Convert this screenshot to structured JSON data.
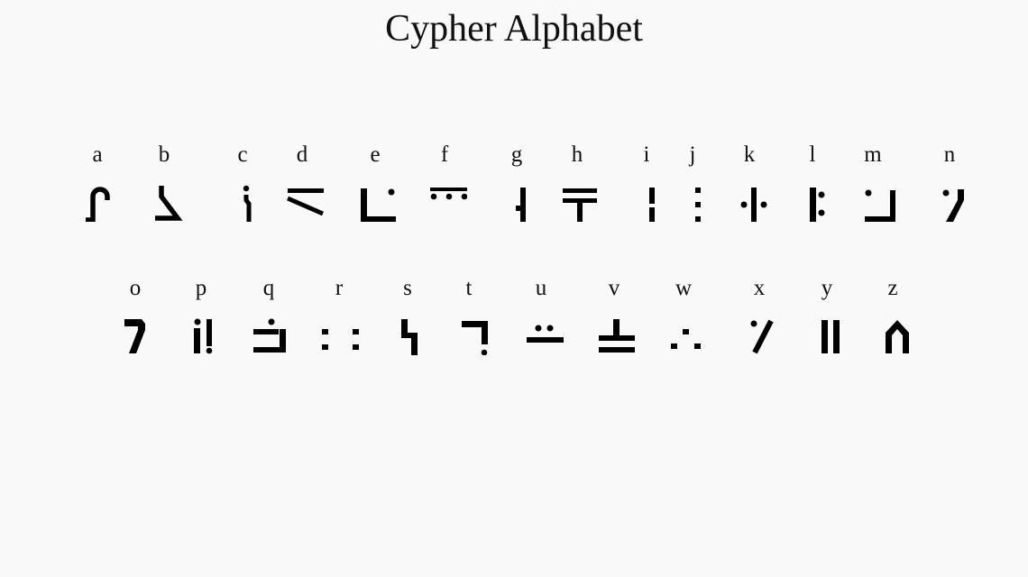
{
  "title": "Cypher Alphabet",
  "background_color": "#f9f9f9",
  "glyph_color": "#000000",
  "rows": [
    {
      "glyphs": [
        {
          "letter": "a",
          "icon": "hook-arch-icon"
        },
        {
          "letter": "b",
          "icon": "slanted-angle-icon"
        },
        {
          "letter": "c",
          "icon": "dotted-bent-stroke-icon"
        },
        {
          "letter": "d",
          "icon": "bar-over-slash-icon"
        },
        {
          "letter": "e",
          "icon": "l-corner-with-dot-icon"
        },
        {
          "letter": "f",
          "icon": "bar-over-three-dots-icon"
        },
        {
          "letter": "g",
          "icon": "stroke-with-left-notch-icon"
        },
        {
          "letter": "h",
          "icon": "double-bar-with-stem-icon"
        },
        {
          "letter": "i",
          "icon": "broken-vertical-icon"
        },
        {
          "letter": "j",
          "icon": "three-square-dots-icon"
        },
        {
          "letter": "k",
          "icon": "stroke-with-side-dots-icon"
        },
        {
          "letter": "l",
          "icon": "stroke-with-colon-icon"
        },
        {
          "letter": "m",
          "icon": "dot-with-reverse-l-icon"
        },
        {
          "letter": "n",
          "icon": "dot-with-slanted-hook-icon"
        }
      ]
    },
    {
      "glyphs": [
        {
          "letter": "o",
          "icon": "seven-shape-icon"
        },
        {
          "letter": "p",
          "icon": "i-and-exclamation-icon"
        },
        {
          "letter": "q",
          "icon": "dotted-bracket-icon"
        },
        {
          "letter": "r",
          "icon": "four-square-dots-icon"
        },
        {
          "letter": "s",
          "icon": "zigzag-step-icon"
        },
        {
          "letter": "t",
          "icon": "hook-with-dot-icon"
        },
        {
          "letter": "u",
          "icon": "two-dots-over-bar-icon"
        },
        {
          "letter": "v",
          "icon": "inverted-t-over-bar-icon"
        },
        {
          "letter": "w",
          "icon": "therefore-dots-icon"
        },
        {
          "letter": "x",
          "icon": "dot-with-slash-icon"
        },
        {
          "letter": "y",
          "icon": "double-vertical-bars-icon"
        },
        {
          "letter": "z",
          "icon": "pointed-arch-icon"
        }
      ]
    }
  ]
}
